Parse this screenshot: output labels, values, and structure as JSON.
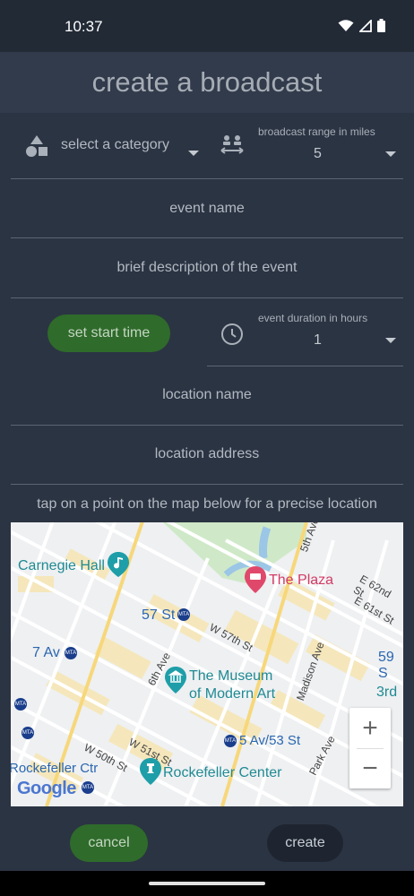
{
  "status": {
    "time": "10:37"
  },
  "header": {
    "title": "create a broadcast"
  },
  "form": {
    "category_placeholder": "select a category",
    "range_label": "broadcast range in miles",
    "range_value": "5",
    "event_name_placeholder": "event name",
    "description_placeholder": "brief description of the event",
    "start_time_button": "set start time",
    "duration_label": "event duration in hours",
    "duration_value": "1",
    "location_name_placeholder": "location name",
    "location_address_placeholder": "location address",
    "map_hint": "tap on a point on the map below for a precise location"
  },
  "map": {
    "labels": {
      "carnegie_hall": "Carnegie Hall",
      "the_plaza": "The Plaza",
      "st57": "57 St",
      "w57": "W 57th St",
      "av7": "7 Av",
      "moma_line1": "The Museum",
      "moma_line2": "of Modern Art",
      "ave6": "6th Ave",
      "madison": "Madison Ave",
      "ave5": "5th Ave",
      "e62": "E 62nd St",
      "e61": "E 61st St",
      "st59": "59 S",
      "rd3": "3rd",
      "w50": "W 50th St",
      "w51": "W 51st St",
      "av5_53": "5 Av/53 St",
      "park_ave": "Park Ave",
      "rockefeller_ctr": "Rockefeller Ctr",
      "rockefeller_center": "Rockefeller Center",
      "google": "Google",
      "mta": "MTA"
    },
    "zoom_in": "+",
    "zoom_out": "−"
  },
  "actions": {
    "cancel": "cancel",
    "create": "create"
  },
  "colors": {
    "background": "#2b3443",
    "green_button": "#2f6b2b",
    "dark_button": "#1f2530",
    "map_pin_red": "#e0486b",
    "map_pin_teal": "#1e9ea8"
  }
}
